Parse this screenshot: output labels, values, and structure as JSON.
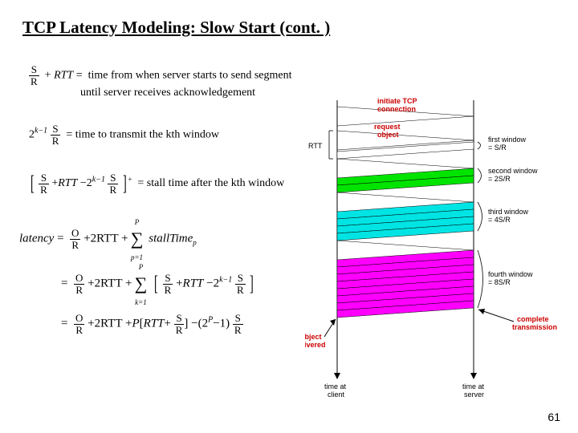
{
  "title": "TCP Latency Modeling: Slow Start (cont. )",
  "eq": {
    "sr_rtt": "time from when server starts to send segment",
    "sr_rtt2": "until server receives acknowledgement",
    "kthwin": "time to transmit the kth window",
    "stall": "stall time after the kth window",
    "latency_word": "latency",
    "itimes": "stallTime",
    "rtt_word": "RTT",
    "S": "S",
    "R": "R",
    "O": "O",
    "two": "2",
    "twoRTT": "2RTT",
    "plus": "+",
    "minus": "−",
    "eq": "=",
    "P": "P",
    "psub": "p",
    "k": "k",
    "lparen": "(",
    "rparen": ")",
    "one": "1"
  },
  "labels": {
    "init_tcp": "initiate TCP",
    "init_conn": "connection",
    "req": "request",
    "obj": "object",
    "rtt": "RTT",
    "w1a": "first window",
    "w1b": "= S/R",
    "w2a": "second window",
    "w2b": "= 2S/R",
    "w3a": "third window",
    "w3b": "= 4S/R",
    "w4a": "fourth window",
    "w4b": "= 8S/R",
    "compa": "complete",
    "compb": "transmission",
    "delivereda": "object",
    "deliveredb": "delivered",
    "timecl": "time at",
    "timeclb": "client",
    "timesv": "time at",
    "timesvb": "server"
  },
  "page": "61"
}
